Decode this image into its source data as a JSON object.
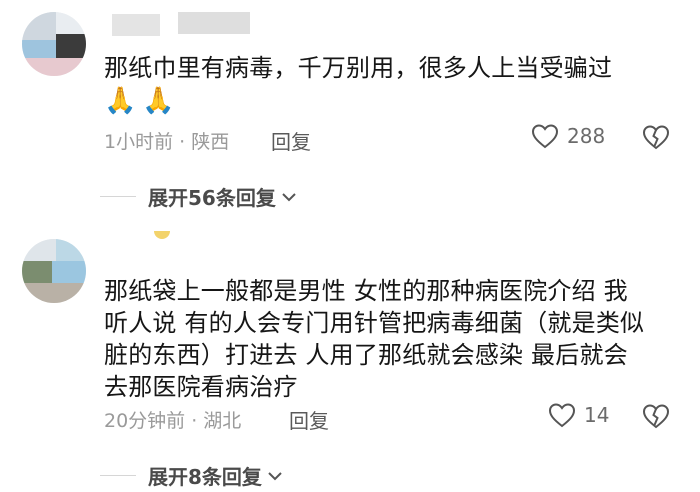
{
  "comments": [
    {
      "text": "那纸巾里有病毒，千万别用，很多人上当受骗过",
      "emoji": [
        "🙏",
        "🙏"
      ],
      "meta": "1小时前 · 陕西",
      "reply_label": "回复",
      "likes": "288",
      "expand_label": "展开56条回复"
    },
    {
      "text": "那纸袋上一般都是男性 女性的那种病医院介绍 我\n听人说 有的人会专门用针管把病毒细菌（就是类似\n脏的东西）打进去 人用了那纸就会感染 最后就会\n去那医院看病治疗",
      "meta": "20分钟前 · 湖北",
      "reply_label": "回复",
      "likes": "14",
      "expand_label": "展开8条回复"
    }
  ],
  "colors": {
    "text": "#161616",
    "meta": "#9a9a9a",
    "icon": "#555555"
  }
}
